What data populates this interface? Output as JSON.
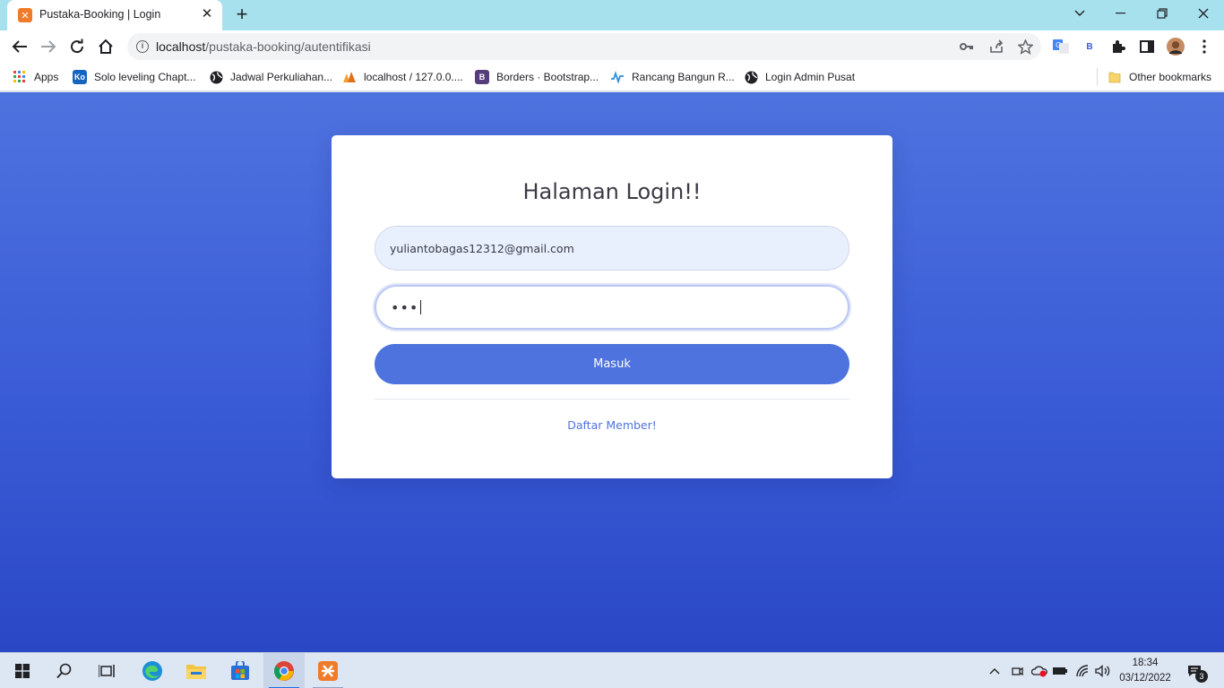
{
  "browser": {
    "tab": {
      "title": "Pustaka-Booking | Login",
      "favicon": "xampp-icon"
    },
    "address_bar": {
      "host": "localhost",
      "path": "/pustaka-booking/autentifikasi"
    },
    "bookmarks": [
      {
        "label": "Apps",
        "icon": "apps-grid-icon"
      },
      {
        "label": "Solo leveling Chapt...",
        "icon": "komik-icon",
        "color": "#1565c0"
      },
      {
        "label": "Jadwal Perkuliahan...",
        "icon": "globe-icon"
      },
      {
        "label": "localhost / 127.0.0....",
        "icon": "phpmyadmin-icon"
      },
      {
        "label": "Borders · Bootstrap...",
        "icon": "bootstrap-icon",
        "color": "#563d7c"
      },
      {
        "label": "Rancang Bangun R...",
        "icon": "wave-icon"
      },
      {
        "label": "Login Admin Pusat",
        "icon": "globe-icon"
      }
    ],
    "other_bookmarks": "Other bookmarks"
  },
  "login": {
    "title": "Halaman Login!!",
    "email_value": "yuliantobagas12312@gmail.com",
    "password_mask": "•••",
    "submit_label": "Masuk",
    "register_link": "Daftar Member!"
  },
  "colors": {
    "primary": "#4e73df",
    "page_bg_top": "#4e73df",
    "page_bg_bottom": "#2a48c6"
  },
  "taskbar": {
    "time": "18:34",
    "date": "03/12/2022",
    "notification_count": "3"
  }
}
